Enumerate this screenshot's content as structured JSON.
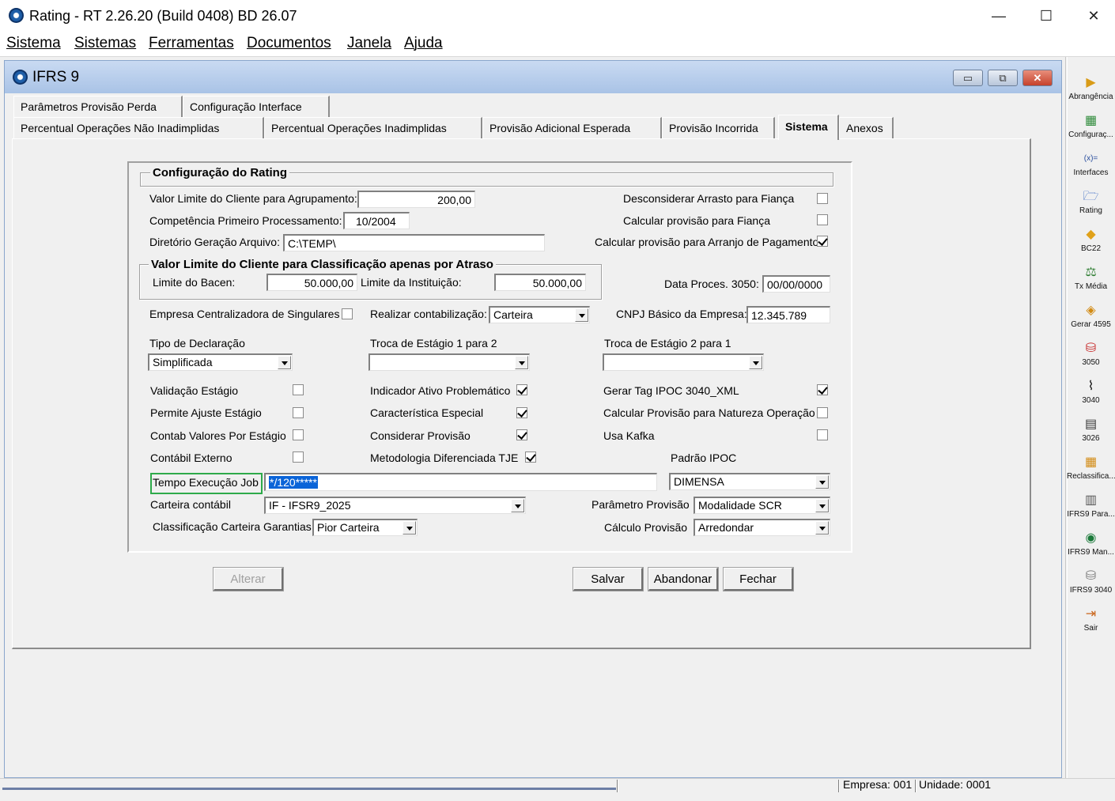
{
  "window": {
    "title": "Rating - RT 2.26.20 (Build 0408) BD 26.07",
    "minimize": "—",
    "maximize": "☐",
    "close": "✕"
  },
  "menu": [
    "Sistema",
    "Sistemas",
    "Ferramentas",
    "Documentos",
    "Janela",
    "Ajuda"
  ],
  "child": {
    "title": "IFRS 9",
    "min": "▭",
    "restore": "⧉",
    "close": "✕"
  },
  "tabs_row1": [
    "Parâmetros Provisão Perda",
    "Configuração Interface"
  ],
  "tabs_row2": [
    "Percentual Operações Não Inadimplidas",
    "Percentual Operações Inadimplidas",
    "Provisão Adicional Esperada",
    "Provisão Incorrida",
    "Sistema",
    "Anexos"
  ],
  "active_tab": "Sistema",
  "config": {
    "group_title": "Configuração do Rating",
    "valor_limite_label": "Valor Limite do Cliente para Agrupamento:",
    "valor_limite_value": "200,00",
    "competencia_label": "Competência Primeiro Processamento:",
    "competencia_value": "10/2004",
    "diretorio_label": "Diretório Geração Arquivo:",
    "diretorio_value": "C:\\TEMP\\",
    "desconsiderar_label": "Desconsiderar Arrasto para Fiança",
    "desconsiderar_checked": false,
    "calc_fianca_label": "Calcular provisão para Fiança",
    "calc_fianca_checked": false,
    "calc_arranjo_label": "Calcular provisão para Arranjo de Pagamento",
    "calc_arranjo_checked": true
  },
  "atraso": {
    "group_title": "Valor Limite do Cliente para Classificação apenas por Atraso",
    "bacen_label": "Limite do Bacen:",
    "bacen_value": "50.000,00",
    "instituicao_label": "Limite da Instituição:",
    "instituicao_value": "50.000,00"
  },
  "data_proces_label": "Data Proces. 3050:",
  "data_proces_value": "00/00/0000",
  "empresa_central_label": "Empresa Centralizadora de Singulares",
  "empresa_central_checked": false,
  "contabilizacao_label": "Realizar contabilização:",
  "contabilizacao_value": "Carteira",
  "cnpj_label": "CNPJ Básico da Empresa:",
  "cnpj_value": "12.345.789",
  "tipo_decl_label": "Tipo de Declaração",
  "tipo_decl_value": "Simplificada",
  "troca12_label": "Troca de Estágio 1 para 2",
  "troca12_value": "",
  "troca21_label": "Troca de Estágio 2 para 1",
  "troca21_value": "",
  "checks_col1": [
    {
      "label": "Validação Estágio",
      "checked": false
    },
    {
      "label": "Permite Ajuste Estágio",
      "checked": false
    },
    {
      "label": "Contab Valores Por Estágio",
      "checked": false
    },
    {
      "label": "Contábil Externo",
      "checked": false
    }
  ],
  "checks_col2": [
    {
      "label": "Indicador Ativo Problemático",
      "checked": true
    },
    {
      "label": "Característica Especial",
      "checked": true
    },
    {
      "label": "Considerar Provisão",
      "checked": true
    },
    {
      "label": "Metodologia Diferenciada TJE",
      "checked": true
    }
  ],
  "checks_col3": [
    {
      "label": "Gerar Tag IPOC 3040_XML",
      "checked": true
    },
    {
      "label": "Calcular Provisão para Natureza Operação",
      "checked": false
    },
    {
      "label": "Usa Kafka",
      "checked": false
    }
  ],
  "padrao_ipoc_label": "Padrão IPOC",
  "padrao_ipoc_value": "DIMENSA",
  "tempo_job_label": "Tempo Execução Job",
  "tempo_job_value": "*/120*****",
  "carteira_label": "Carteira contábil",
  "carteira_value": "IF - IFSR9_2025",
  "parametro_label": "Parâmetro Provisão",
  "parametro_value": "Modalidade SCR",
  "classif_label": "Classificação Carteira Garantias",
  "classif_value": "Pior Carteira",
  "calculo_label": "Cálculo Provisão",
  "calculo_value": "Arredondar",
  "buttons": {
    "alterar": "Alterar",
    "salvar": "Salvar",
    "abandonar": "Abandonar",
    "fechar": "Fechar"
  },
  "toolbar": [
    {
      "label": "Abrangência",
      "icon": "play-icon",
      "glyph": "▶",
      "color": "#d99b17"
    },
    {
      "label": "Configuraç...",
      "icon": "grid-icon",
      "glyph": "▦",
      "color": "#2e8b3a"
    },
    {
      "label": "Interfaces",
      "icon": "function-icon",
      "glyph": "(x)=",
      "color": "#2a4f9e"
    },
    {
      "label": "Rating",
      "icon": "folder-icon",
      "glyph": "🗁",
      "color": "#2a5fbf"
    },
    {
      "label": "BC22",
      "icon": "cube-icon",
      "glyph": "◆",
      "color": "#e0a11a"
    },
    {
      "label": "Tx Média",
      "icon": "scale-icon",
      "glyph": "⚖",
      "color": "#2e7d32"
    },
    {
      "label": "Gerar 4595",
      "icon": "diamond-icon",
      "glyph": "◈",
      "color": "#d28a12"
    },
    {
      "label": "3050",
      "icon": "database-red-icon",
      "glyph": "⛁",
      "color": "#c62828"
    },
    {
      "label": "3040",
      "icon": "chart-line-icon",
      "glyph": "⌇",
      "color": "#111111"
    },
    {
      "label": "3026",
      "icon": "screen-icon",
      "glyph": "▤",
      "color": "#333333"
    },
    {
      "label": "Reclassifica...",
      "icon": "table-icon",
      "glyph": "▦",
      "color": "#d28a12"
    },
    {
      "label": "IFRS9 Para...",
      "icon": "sheet-icon",
      "glyph": "▥",
      "color": "#555555"
    },
    {
      "label": "IFRS9 Man...",
      "icon": "gauge-icon",
      "glyph": "◉",
      "color": "#1b7a3a"
    },
    {
      "label": "IFRS9 3040",
      "icon": "database-icon",
      "glyph": "⛁",
      "color": "#777777"
    },
    {
      "label": "Sair",
      "icon": "exit-door-icon",
      "glyph": "⇥",
      "color": "#c9651b"
    }
  ],
  "status": {
    "empresa": "Empresa: 001",
    "unidade": "Unidade: 0001"
  }
}
